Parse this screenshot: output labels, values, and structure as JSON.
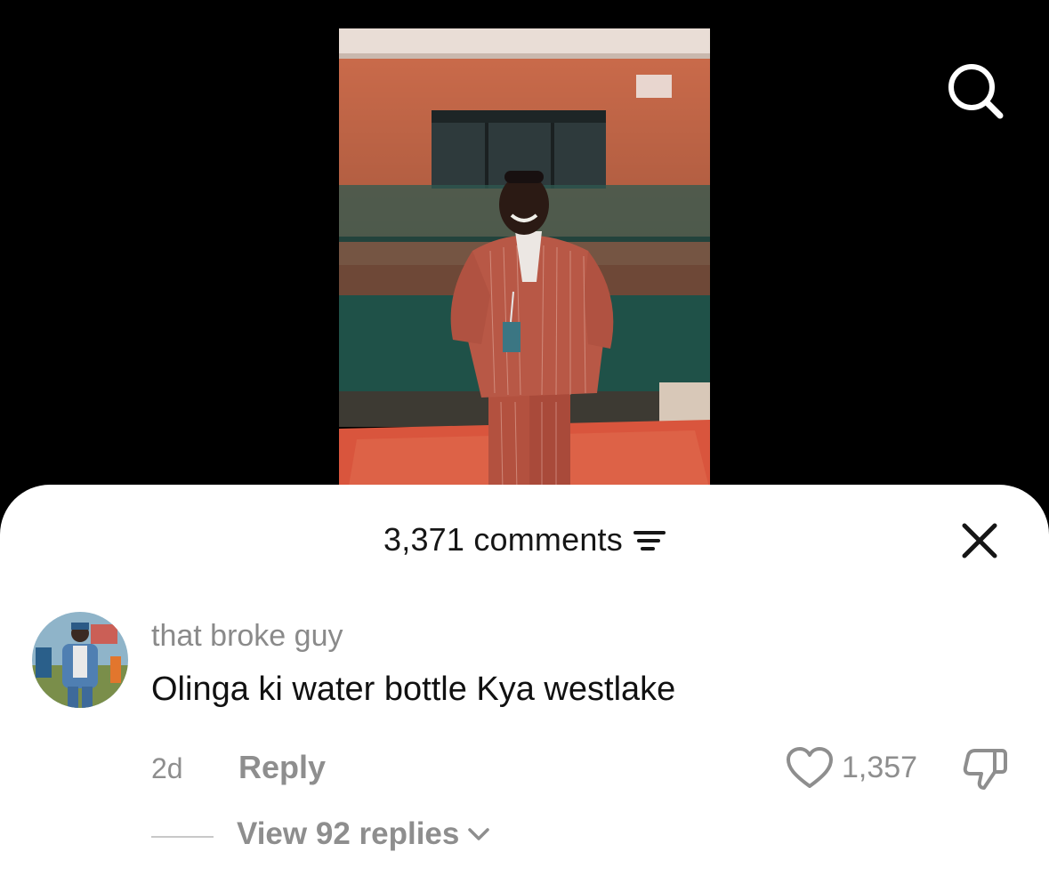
{
  "header": {
    "comments_count_label": "3,371 comments"
  },
  "icons": {
    "search": "search-icon",
    "filter": "filter-icon",
    "close": "close-icon",
    "like": "heart-icon",
    "dislike": "thumbs-down-icon",
    "chevron": "chevron-down-icon"
  },
  "comment": {
    "username": "that broke guy",
    "text": "Olinga ki water bottle Kya westlake",
    "timestamp": "2d",
    "reply_label": "Reply",
    "like_count": "1,357",
    "view_replies_label": "View 92 replies"
  },
  "colors": {
    "sheet_background": "#ffffff",
    "primary_text": "#161616",
    "secondary_text": "#8e8e8e"
  }
}
